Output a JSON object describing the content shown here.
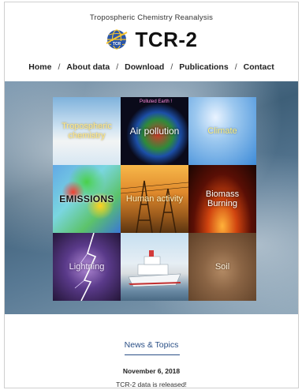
{
  "header": {
    "subtitle": "Tropospheric Chemistry Reanalysis",
    "logo_text": "TCR-2",
    "logo_icon": "globe-logo-icon"
  },
  "nav": {
    "items": [
      {
        "label": "Home"
      },
      {
        "label": "About data"
      },
      {
        "label": "Download"
      },
      {
        "label": "Publications"
      },
      {
        "label": "Contact"
      }
    ],
    "separator": "/"
  },
  "hero": {
    "tiles": [
      {
        "label": "Tropospheric chemistry",
        "image": "clouds-sky"
      },
      {
        "label": "Air pollution",
        "tag": "Polluted Earth !",
        "image": "polluted-earth-globe"
      },
      {
        "label": "Climate",
        "image": "sun-sky"
      },
      {
        "label": "EMISSIONS",
        "image": "emissions-map"
      },
      {
        "label": "Human activity",
        "image": "power-lines-sunset"
      },
      {
        "label": "Biomass Burning",
        "image": "forest-fire"
      },
      {
        "label": "Lightning",
        "image": "lightning-storm"
      },
      {
        "label": "",
        "image": "ship-at-sea"
      },
      {
        "label": "Soil",
        "image": "hand-holding-soil"
      }
    ]
  },
  "news": {
    "title": "News & Topics",
    "date": "November 6, 2018",
    "item": "TCR-2 data is released!"
  },
  "colors": {
    "link_blue": "#2a4f86",
    "text_dark": "#222222"
  }
}
